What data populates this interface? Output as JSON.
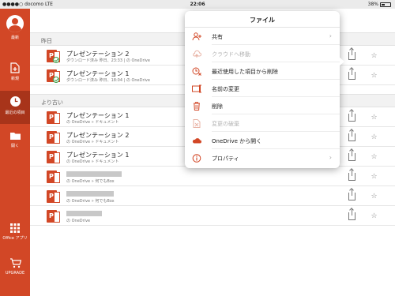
{
  "status_bar": {
    "carrier": "●●●●○ docomo  LTE",
    "time": "22:06",
    "battery": "38%"
  },
  "sidebar": {
    "account_label": "最新",
    "items": [
      {
        "label": "新規",
        "icon": "new-file-icon"
      },
      {
        "label": "最近の項目",
        "icon": "clock-icon"
      },
      {
        "label": "開く",
        "icon": "folder-icon"
      }
    ],
    "apps_label": "Office アプリ",
    "upgrade_label": "UPGRADE"
  },
  "sections": {
    "yesterday": "昨日",
    "older": "より古い"
  },
  "files": [
    {
      "name": "プレゼンテーション 2",
      "sub": "ダウンロード済み 昨日、23:33 | の OneDrive",
      "synced": true
    },
    {
      "name": "プレゼンテーション 1",
      "sub": "ダウンロード済み 昨日、18:04 | の OneDrive",
      "synced": true
    },
    {
      "name": "プレゼンテーション 1",
      "sub": "の OneDrive » ドキュメント",
      "synced": false
    },
    {
      "name": "プレゼンテーション 2",
      "sub": "の OneDrive » ドキュメント",
      "synced": false
    },
    {
      "name": "プレゼンテーション 1",
      "sub": "の OneDrive » ドキュメント",
      "synced": false
    },
    {
      "name": "",
      "sub": "の OneDrive » 何でもBox",
      "synced": false
    },
    {
      "name": "",
      "sub": "の OneDrive » 何でもBox",
      "synced": false
    },
    {
      "name": "",
      "sub": "の OneDrive",
      "synced": false
    }
  ],
  "file_menu": {
    "title": "ファイル",
    "items": [
      {
        "label": "共有",
        "disabled": false,
        "chevron": true,
        "icon": "share-person-icon"
      },
      {
        "label": "クラウドへ移動",
        "disabled": true,
        "chevron": false,
        "icon": "cloud-upload-icon"
      },
      {
        "label": "最近使用した項目から削除",
        "disabled": false,
        "chevron": false,
        "icon": "clock-remove-icon"
      },
      {
        "label": "名前の変更",
        "disabled": false,
        "chevron": false,
        "icon": "rename-icon"
      },
      {
        "label": "削除",
        "disabled": false,
        "chevron": false,
        "icon": "trash-icon"
      },
      {
        "label": "変更の破棄",
        "disabled": true,
        "chevron": false,
        "icon": "discard-icon"
      },
      {
        "label": "OneDrive から開く",
        "disabled": false,
        "chevron": false,
        "icon": "onedrive-cloud-icon"
      },
      {
        "label": "プロパティ",
        "disabled": false,
        "chevron": true,
        "icon": "info-icon"
      }
    ]
  },
  "colors": {
    "accent": "#d24726",
    "accent_dark": "#a8341a",
    "synced_green": "#3fa04c"
  }
}
